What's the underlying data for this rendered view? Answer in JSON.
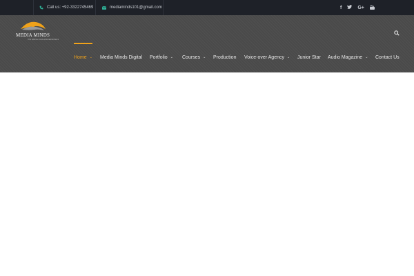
{
  "topbar": {
    "phone": "Call us: +92-3322745469",
    "email": "mediaminds101@gmail.com",
    "social": [
      "f",
      "🐦",
      "G+",
      "▶"
    ]
  },
  "brand": {
    "name": "MEDIA MINDS",
    "tagline": "THE SIMPLE VOICE PROFESSIONALS"
  },
  "nav": {
    "items": [
      {
        "label": "Home",
        "dropdown": true,
        "active": true
      },
      {
        "label": "Media Minds Digital",
        "dropdown": false
      },
      {
        "label": "Portfolio",
        "dropdown": true
      },
      {
        "label": "Courses",
        "dropdown": true
      },
      {
        "label": "Production",
        "dropdown": false
      },
      {
        "label": "Voice-over Agency",
        "dropdown": true
      },
      {
        "label": "Junior Star",
        "dropdown": false
      },
      {
        "label": "Audio Magazine",
        "dropdown": true
      },
      {
        "label": "Contact Us",
        "dropdown": false
      }
    ],
    "caret": "⌄"
  },
  "colors": {
    "accent": "#f0a21a",
    "topbar": "#1e2128",
    "header": "#4a4a4a",
    "icon_teal": "#2fb59a"
  }
}
